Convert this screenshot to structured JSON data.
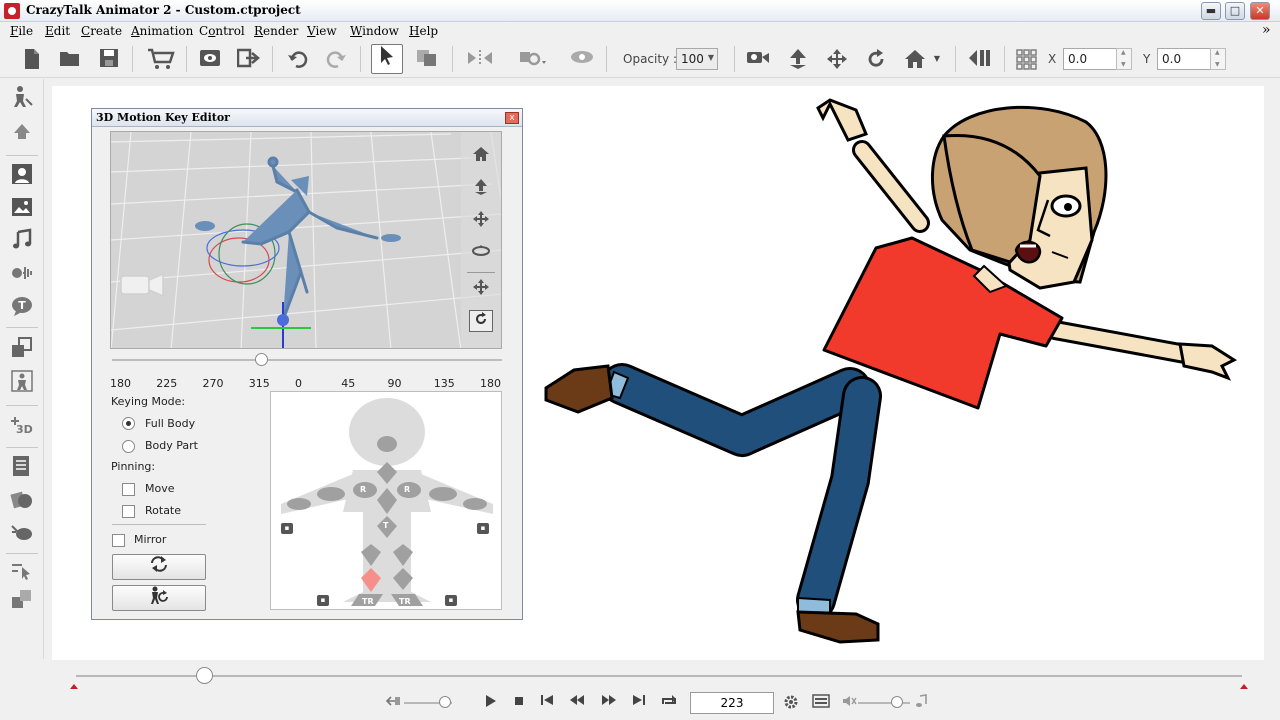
{
  "window": {
    "title": "CrazyTalk Animator 2  - Custom.ctproject",
    "minimize": "▬",
    "maximize": "□",
    "close": "✕",
    "overflow": "»"
  },
  "menu": [
    {
      "label": "File",
      "mnemonic": "F"
    },
    {
      "label": "Edit",
      "mnemonic": "E"
    },
    {
      "label": "Create",
      "mnemonic": "C"
    },
    {
      "label": "Animation",
      "mnemonic": "A"
    },
    {
      "label": "Control",
      "mnemonic": "o"
    },
    {
      "label": "Render",
      "mnemonic": "R"
    },
    {
      "label": "View",
      "mnemonic": "V"
    },
    {
      "label": "Window",
      "mnemonic": "W"
    },
    {
      "label": "Help",
      "mnemonic": "H"
    }
  ],
  "toolbar": {
    "opacity_label": "Opacity :",
    "opacity_value": "100",
    "x_label": "X",
    "x_value": "0.0",
    "y_label": "Y",
    "y_value": "0.0"
  },
  "motion_editor": {
    "title": "3D Motion Key Editor",
    "close": "x",
    "rotation_ticks": [
      "180",
      "225",
      "270",
      "315",
      "0",
      "45",
      "90",
      "135",
      "180"
    ],
    "rotation_value": 315,
    "keying_mode_label": "Keying Mode:",
    "full_body": "Full Body",
    "body_part": "Body Part",
    "keying_mode_selected": "Full Body",
    "pinning_label": "Pinning:",
    "move": "Move",
    "rotate": "Rotate",
    "mirror": "Mirror",
    "bodymap_tags": {
      "r": "R",
      "t": "T",
      "tr": "TR"
    }
  },
  "timeline": {
    "frame": "223",
    "playhead": 0.11,
    "speed": 0.85,
    "volume": 0.75
  },
  "colors": {
    "shirt": "#f23a2c",
    "pants": "#1f4f7a",
    "shoes": "#6b3a16",
    "skin": "#f6e3c1",
    "hair": "#c9a273",
    "selected_part": "#f48f8a"
  }
}
